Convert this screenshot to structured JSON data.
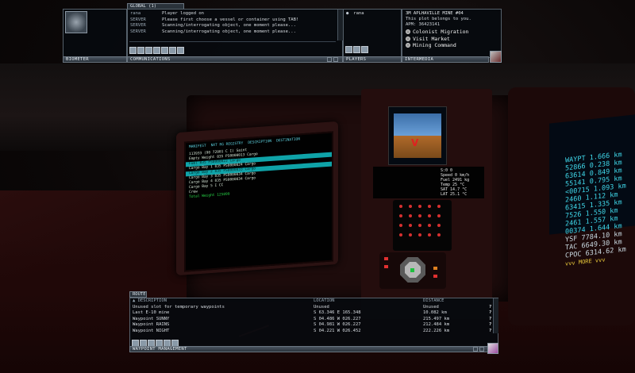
{
  "global_tab": "GLOBAL (1)",
  "biometer": {
    "title": "BIOMETER"
  },
  "communications": {
    "title": "COMMUNICATIONS",
    "messages": [
      {
        "source": "rana",
        "text": "Player logged on"
      },
      {
        "source": "SERVER",
        "text": "Please first choose a vessel or container using TAB!"
      },
      {
        "source": "SERVER",
        "text": "Scanning/interrogating object, one moment please..."
      },
      {
        "source": "SERVER",
        "text": "Scanning/interrogating object, one moment please..."
      }
    ]
  },
  "players": {
    "title": "PLAYERS",
    "list": [
      "rana"
    ]
  },
  "intermedia": {
    "title": "INTERMEDIA",
    "heading": "3M APLHAVILLE MINE #04",
    "subheading": "This plot belongs to you.",
    "apm": "APM: 36423141",
    "options": [
      "Colonist Migration",
      "Visit Market",
      "Mining Command"
    ]
  },
  "cockpit_monitor": {
    "headers": [
      "MANIFEST",
      "NXT RG REGISTRY",
      "DESCRIPTION",
      "DESTINATION"
    ],
    "lines": [
      {
        "text": "               113933 (90 72001 C I) Saint",
        "style": ""
      },
      {
        "text": "Empty Weight   835 PS0000013 Cargo",
        "style": ""
      },
      {
        "text": "Fuel           835 PS0000023 Cargo",
        "style": "sel"
      },
      {
        "text": "Cargo Bay 1    835 PS0000024 Cargo",
        "style": ""
      },
      {
        "text": "Cargo Bay 2    835 PS0000033 Cargo",
        "style": "sel"
      },
      {
        "text": "Cargo Bay 3    835 PS0000034 Cargo",
        "style": ""
      },
      {
        "text": "Cargo Bay 4    835 PS0000034 Cargo",
        "style": ""
      },
      {
        "text": "Cargo Bay 5                  I CC",
        "style": ""
      },
      {
        "text": "Crew",
        "style": ""
      },
      {
        "text": "Total Weight   125099",
        "style": "green"
      }
    ]
  },
  "right_display": {
    "lines": [
      "WAYPT  1.666 km",
      "52866  0.238 km",
      "63614  0.849 km",
      "55141  0.795 km",
      "<00715 1.093 km",
      "2460   1.112 km",
      "63415  1.335 km",
      "7526   1.550 km",
      "2461   1.557 km",
      "00374  1.644 km",
      "YSF    7784.10 km",
      "TAC    6649.30 km",
      "CPOC   6314.62 km"
    ],
    "footer": "vvv MORE vvv"
  },
  "center_readouts": [
    "S:0  0",
    "Speed 0 km/h",
    "Fuel 2491 kg",
    "Temp 25 °C",
    "SAT 14.7 °C",
    "LAT 25.1 °C"
  ],
  "route": {
    "tab": "ROUTE",
    "title": "WAYPOINT MANAGEMENT",
    "columns": [
      "▲ DESCRIPTION",
      "LOCATION",
      "DISTANCE"
    ],
    "rows": [
      {
        "description": "Unused slot for temporary waypoints",
        "location": "Unused",
        "distance": "Unused"
      },
      {
        "description": "Last E-10 mine",
        "location": "S 63.346 E 165.348",
        "distance": "10.082 km"
      },
      {
        "description": "Waypoint SUNNY",
        "location": "S 04.486 W 026.227",
        "distance": "215.497 km"
      },
      {
        "description": "Waypoint RAINS",
        "location": "S 04.981 W 026.227",
        "distance": "212.484 km"
      },
      {
        "description": "Waypoint NIGHT",
        "location": "S 04.221 W 026.452",
        "distance": "222.226 km"
      }
    ],
    "help_symbol": "?"
  }
}
